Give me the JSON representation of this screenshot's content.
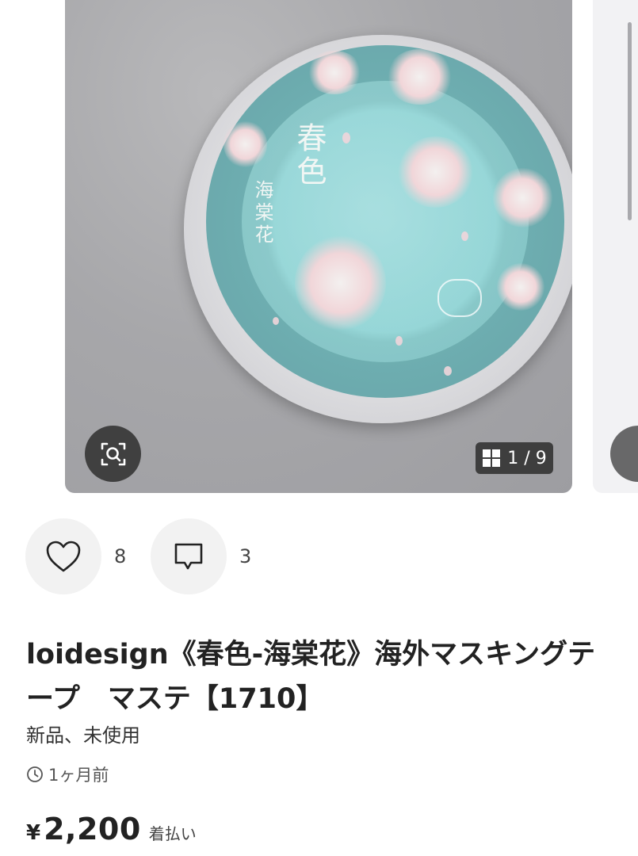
{
  "gallery": {
    "image_alt_text": "",
    "tape_title": "春色",
    "tape_subtitle": "海棠花",
    "counter": "1 / 9",
    "zoom_icon": "zoom-search-icon",
    "counter_icon": "grid-icon"
  },
  "engagement": {
    "like_icon": "heart-icon",
    "like_count": "8",
    "comment_icon": "comment-icon",
    "comment_count": "3"
  },
  "item": {
    "title": "loidesign《春色-海棠花》海外マスキングテープ　マステ【1710】",
    "condition": "新品、未使用",
    "posted": "1ヶ月前",
    "currency": "¥",
    "price": "2,200",
    "shipping": "着払い"
  },
  "colors": {
    "tape_teal": "#6fb0b2",
    "overlay_dark": "#323232",
    "button_bg": "#f2f2f2"
  }
}
